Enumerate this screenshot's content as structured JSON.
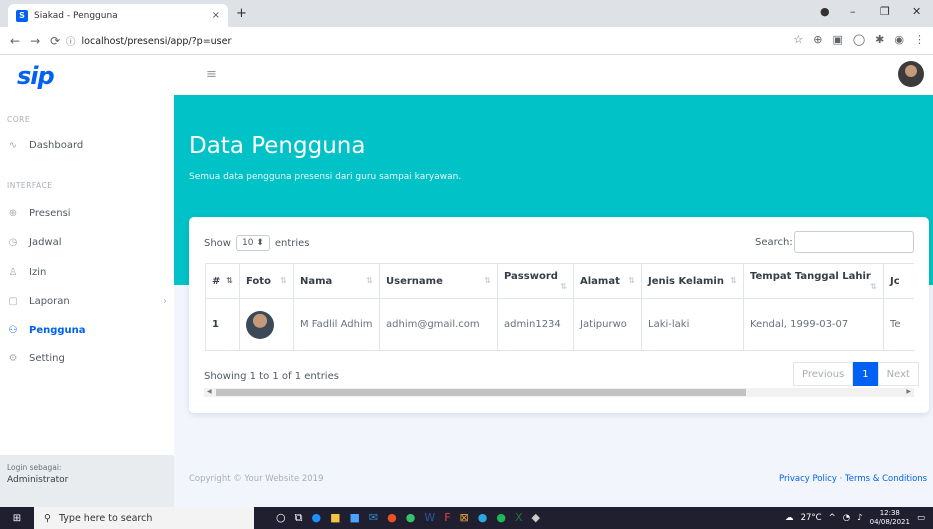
{
  "browser": {
    "tab_title": "Siakad - Pengguna",
    "tab_close": "×",
    "new_tab": "+",
    "url": "localhost/presensi/app/?p=user"
  },
  "brand": {
    "logo": "sip"
  },
  "sidebar": {
    "heading_core": "CORE",
    "heading_interface": "INTERFACE",
    "items": [
      {
        "label": "Dashboard",
        "icon": "activity-icon"
      },
      {
        "label": "Presensi",
        "icon": "globe-icon"
      },
      {
        "label": "Jadwal",
        "icon": "clock-icon"
      },
      {
        "label": "Izin",
        "icon": "user-plus-icon"
      },
      {
        "label": "Laporan",
        "icon": "folder-icon"
      },
      {
        "label": "Pengguna",
        "icon": "users-icon"
      },
      {
        "label": "Setting",
        "icon": "settings-icon"
      }
    ],
    "caret": "›",
    "footer_label": "Login sebagai:",
    "footer_role": "Administrator"
  },
  "header": {
    "title": "Data Pengguna",
    "subtitle": "Semua data pengguna presensi dari guru sampai karyawan."
  },
  "table": {
    "show_label": "Show",
    "entries_label": "entries",
    "page_size": "10",
    "search_label": "Search:",
    "columns": [
      "#",
      "Foto",
      "Nama",
      "Username",
      "Password",
      "Alamat",
      "Jenis Kelamin",
      "Tempat Tanggal Lahir",
      "Jc"
    ],
    "rows": [
      [
        "1",
        "",
        "M Fadlil Adhim",
        "adhim@gmail.com",
        "admin1234",
        "Jatipurwo",
        "Laki-laki",
        "Kendal, 1999-03-07",
        "Te"
      ]
    ],
    "info": "Showing 1 to 1 of 1 entries",
    "prev": "Previous",
    "page": "1",
    "next": "Next"
  },
  "footer": {
    "copyright": "Copyright © Your Website 2019",
    "privacy": "Privacy Policy",
    "sep": " · ",
    "terms": "Terms & Conditions"
  },
  "taskbar": {
    "search_placeholder": "Type here to search",
    "weather": "27°C",
    "time": "12:38",
    "date": "04/08/2021"
  },
  "colors": {
    "primary": "#0061f2",
    "hero": "#00c2c7"
  }
}
